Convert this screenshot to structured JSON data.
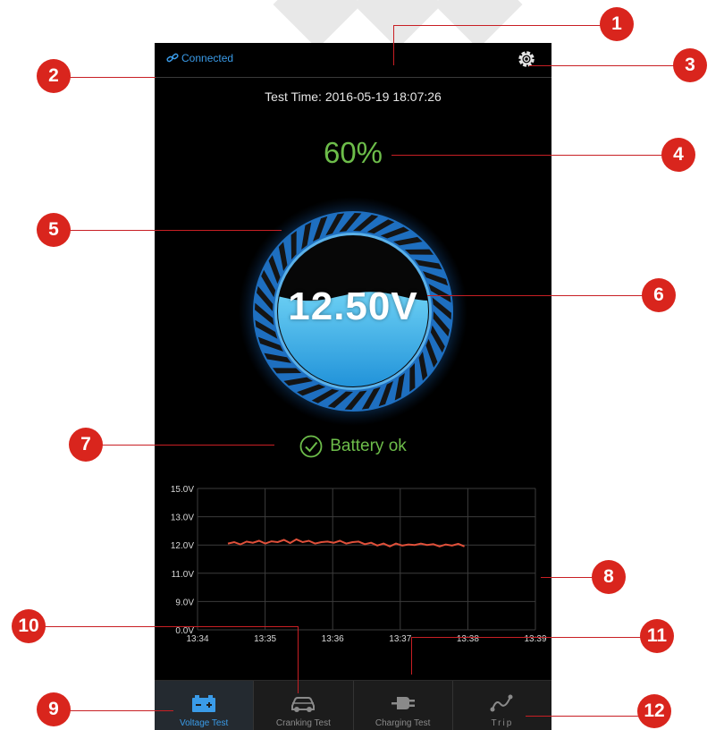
{
  "status_bar": {
    "connection": "Connected"
  },
  "test_time": {
    "label": "Test Time:",
    "value": "2016-05-19 18:07:26"
  },
  "battery": {
    "percent": "60%",
    "voltage": "12.50V",
    "status": "Battery ok",
    "fill_fraction": 0.6
  },
  "colors": {
    "accent": "#3a9be8",
    "ok": "#6dbd4a",
    "trace": "#e0503a",
    "callout": "#d9251d"
  },
  "chart_data": {
    "type": "line",
    "y_ticks": [
      "15.0V",
      "13.0V",
      "12.0V",
      "11.0V",
      "9.0V",
      "0.0V"
    ],
    "x_ticks": [
      "13:34",
      "13:35",
      "13:36",
      "13:37",
      "13:38",
      "13:39"
    ],
    "grid": true,
    "series": [
      {
        "values": [
          12.05,
          12.1,
          12.02,
          12.12,
          12.08,
          12.15,
          12.05,
          12.13,
          12.1,
          12.18,
          12.07,
          12.2,
          12.1,
          12.15,
          12.05,
          12.1,
          12.12,
          12.08,
          12.15,
          12.05,
          12.1,
          12.12,
          12.03,
          12.08,
          11.98,
          12.05,
          11.95,
          12.05,
          11.98,
          12.02,
          12.0,
          12.05,
          12.0,
          12.03,
          11.95,
          12.02,
          11.98,
          12.04,
          11.95
        ]
      }
    ]
  },
  "tabs": [
    {
      "label": "Voltage Test",
      "icon": "battery-icon",
      "active": true
    },
    {
      "label": "Cranking Test",
      "icon": "car-icon",
      "active": false
    },
    {
      "label": "Charging Test",
      "icon": "plug-icon",
      "active": false
    },
    {
      "label": "Trip",
      "icon": "route-icon",
      "active": false
    }
  ],
  "callouts": [
    "1",
    "2",
    "3",
    "4",
    "5",
    "6",
    "7",
    "8",
    "9",
    "10",
    "11",
    "12"
  ]
}
